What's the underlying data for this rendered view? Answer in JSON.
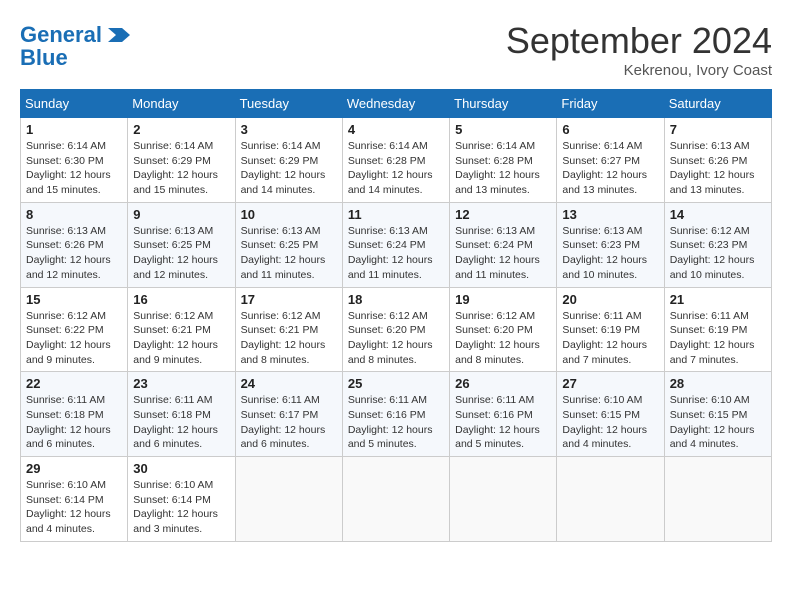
{
  "header": {
    "logo_line1": "General",
    "logo_line2": "Blue",
    "month_title": "September 2024",
    "location": "Kekrenou, Ivory Coast"
  },
  "weekdays": [
    "Sunday",
    "Monday",
    "Tuesday",
    "Wednesday",
    "Thursday",
    "Friday",
    "Saturday"
  ],
  "weeks": [
    [
      {
        "day": "1",
        "sunrise": "6:14 AM",
        "sunset": "6:30 PM",
        "daylight": "12 hours and 15 minutes."
      },
      {
        "day": "2",
        "sunrise": "6:14 AM",
        "sunset": "6:29 PM",
        "daylight": "12 hours and 15 minutes."
      },
      {
        "day": "3",
        "sunrise": "6:14 AM",
        "sunset": "6:29 PM",
        "daylight": "12 hours and 14 minutes."
      },
      {
        "day": "4",
        "sunrise": "6:14 AM",
        "sunset": "6:28 PM",
        "daylight": "12 hours and 14 minutes."
      },
      {
        "day": "5",
        "sunrise": "6:14 AM",
        "sunset": "6:28 PM",
        "daylight": "12 hours and 13 minutes."
      },
      {
        "day": "6",
        "sunrise": "6:14 AM",
        "sunset": "6:27 PM",
        "daylight": "12 hours and 13 minutes."
      },
      {
        "day": "7",
        "sunrise": "6:13 AM",
        "sunset": "6:26 PM",
        "daylight": "12 hours and 13 minutes."
      }
    ],
    [
      {
        "day": "8",
        "sunrise": "6:13 AM",
        "sunset": "6:26 PM",
        "daylight": "12 hours and 12 minutes."
      },
      {
        "day": "9",
        "sunrise": "6:13 AM",
        "sunset": "6:25 PM",
        "daylight": "12 hours and 12 minutes."
      },
      {
        "day": "10",
        "sunrise": "6:13 AM",
        "sunset": "6:25 PM",
        "daylight": "12 hours and 11 minutes."
      },
      {
        "day": "11",
        "sunrise": "6:13 AM",
        "sunset": "6:24 PM",
        "daylight": "12 hours and 11 minutes."
      },
      {
        "day": "12",
        "sunrise": "6:13 AM",
        "sunset": "6:24 PM",
        "daylight": "12 hours and 11 minutes."
      },
      {
        "day": "13",
        "sunrise": "6:13 AM",
        "sunset": "6:23 PM",
        "daylight": "12 hours and 10 minutes."
      },
      {
        "day": "14",
        "sunrise": "6:12 AM",
        "sunset": "6:23 PM",
        "daylight": "12 hours and 10 minutes."
      }
    ],
    [
      {
        "day": "15",
        "sunrise": "6:12 AM",
        "sunset": "6:22 PM",
        "daylight": "12 hours and 9 minutes."
      },
      {
        "day": "16",
        "sunrise": "6:12 AM",
        "sunset": "6:21 PM",
        "daylight": "12 hours and 9 minutes."
      },
      {
        "day": "17",
        "sunrise": "6:12 AM",
        "sunset": "6:21 PM",
        "daylight": "12 hours and 8 minutes."
      },
      {
        "day": "18",
        "sunrise": "6:12 AM",
        "sunset": "6:20 PM",
        "daylight": "12 hours and 8 minutes."
      },
      {
        "day": "19",
        "sunrise": "6:12 AM",
        "sunset": "6:20 PM",
        "daylight": "12 hours and 8 minutes."
      },
      {
        "day": "20",
        "sunrise": "6:11 AM",
        "sunset": "6:19 PM",
        "daylight": "12 hours and 7 minutes."
      },
      {
        "day": "21",
        "sunrise": "6:11 AM",
        "sunset": "6:19 PM",
        "daylight": "12 hours and 7 minutes."
      }
    ],
    [
      {
        "day": "22",
        "sunrise": "6:11 AM",
        "sunset": "6:18 PM",
        "daylight": "12 hours and 6 minutes."
      },
      {
        "day": "23",
        "sunrise": "6:11 AM",
        "sunset": "6:18 PM",
        "daylight": "12 hours and 6 minutes."
      },
      {
        "day": "24",
        "sunrise": "6:11 AM",
        "sunset": "6:17 PM",
        "daylight": "12 hours and 6 minutes."
      },
      {
        "day": "25",
        "sunrise": "6:11 AM",
        "sunset": "6:16 PM",
        "daylight": "12 hours and 5 minutes."
      },
      {
        "day": "26",
        "sunrise": "6:11 AM",
        "sunset": "6:16 PM",
        "daylight": "12 hours and 5 minutes."
      },
      {
        "day": "27",
        "sunrise": "6:10 AM",
        "sunset": "6:15 PM",
        "daylight": "12 hours and 4 minutes."
      },
      {
        "day": "28",
        "sunrise": "6:10 AM",
        "sunset": "6:15 PM",
        "daylight": "12 hours and 4 minutes."
      }
    ],
    [
      {
        "day": "29",
        "sunrise": "6:10 AM",
        "sunset": "6:14 PM",
        "daylight": "12 hours and 4 minutes."
      },
      {
        "day": "30",
        "sunrise": "6:10 AM",
        "sunset": "6:14 PM",
        "daylight": "12 hours and 3 minutes."
      },
      null,
      null,
      null,
      null,
      null
    ]
  ]
}
